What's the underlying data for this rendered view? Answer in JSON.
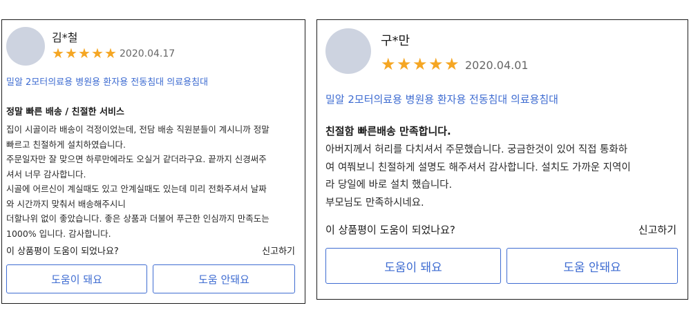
{
  "colors": {
    "star": "#f5a623",
    "link": "#3d6bd1",
    "avatar": "#cdd3e0",
    "border": "#1a1a1a"
  },
  "reviews": [
    {
      "reviewer": "김*철",
      "rating": 5,
      "date": "2020.04.17",
      "product": "밀알 2모터의료용 병원용 환자용 전동침대 의료용침대",
      "title": "정말 빠른 배송 / 친절한 서비스",
      "body_lines": [
        "집이 시골이라 배송이 걱정이었는데, 전담 배송 직원분들이 계시니까 정말",
        "빠르고 친절하게 설치하였습니다.",
        "주문일자만 잘 맞으면 하루만에라도 오실거 같더라구요. 끝까지 신경써주",
        "셔서 너무 감사합니다.",
        "시골에 어르신이 계실때도 있고 안계실때도 있는데 미리 전화주셔서 날짜",
        "와 시간까지 맞춰서 배송해주시니",
        "더할나위 없이 좋았습니다. 좋은 상품과 더불어 푸근한 인심까지 만족도는",
        "1000% 입니다. 감사합니다."
      ],
      "helpful_question": "이 상품평이 도움이 되었나요?",
      "report_label": "신고하기",
      "helpful_yes": "도움이 돼요",
      "helpful_no": "도움 안돼요"
    },
    {
      "reviewer": "구*만",
      "rating": 5,
      "date": "2020.04.01",
      "product": "밀알 2모터의료용 병원용 환자용 전동침대 의료용침대",
      "title": "친절함 빠른배송 만족합니다.",
      "body_lines": [
        "아버지께서 허리를 다치셔서 주문했습니다. 궁금한것이 있어 직접 통화하",
        "여 여쭤보니 친절하게 설명도 해주셔서 감사합니다. 설치도 가까운 지역이",
        "라 당일에 바로 설치 했습니다.",
        "부모님도 만족하시네요."
      ],
      "helpful_question": "이 상품평이 도움이 되었나요?",
      "report_label": "신고하기",
      "helpful_yes": "도움이 돼요",
      "helpful_no": "도움 안돼요"
    }
  ]
}
